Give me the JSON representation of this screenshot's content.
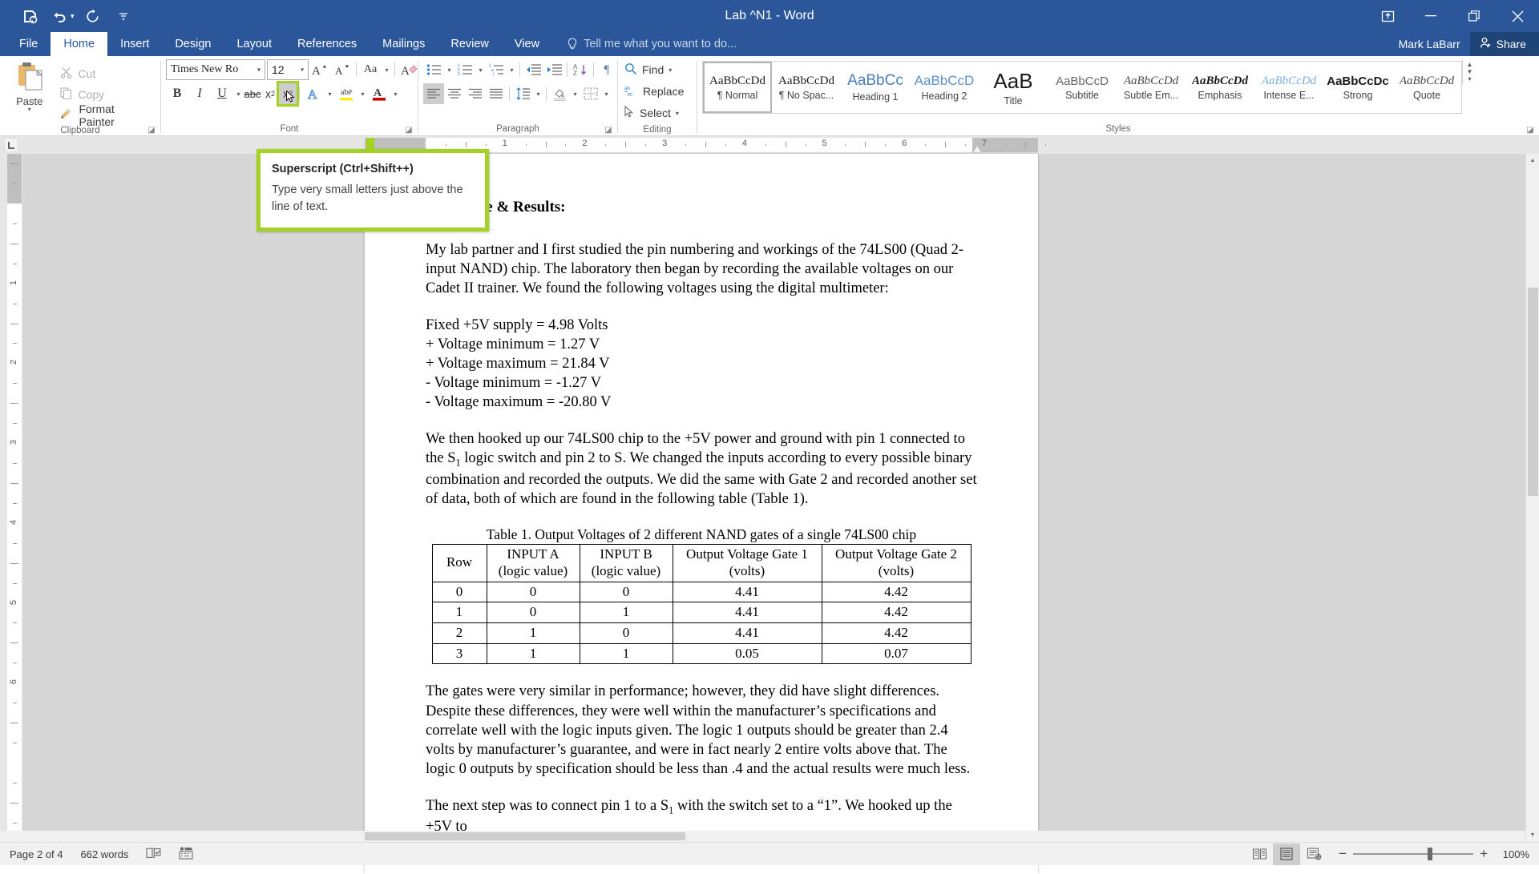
{
  "titlebar": {
    "document_title": "Lab ^N1 - Word",
    "quick_access": [
      {
        "name": "save-icon",
        "label": "Save"
      },
      {
        "name": "undo-icon",
        "label": "Undo"
      },
      {
        "name": "redo-icon",
        "label": "Redo"
      },
      {
        "name": "customize-qat-icon",
        "label": "Customize Quick Access Toolbar"
      }
    ],
    "window_controls": [
      {
        "name": "ribbon-display-options-icon",
        "label": "Ribbon Display Options"
      },
      {
        "name": "minimize-icon",
        "label": "Minimize"
      },
      {
        "name": "restore-icon",
        "label": "Restore Down"
      },
      {
        "name": "close-icon",
        "label": "Close"
      }
    ]
  },
  "tabs": [
    {
      "label": "File",
      "active": false
    },
    {
      "label": "Home",
      "active": true
    },
    {
      "label": "Insert",
      "active": false
    },
    {
      "label": "Design",
      "active": false
    },
    {
      "label": "Layout",
      "active": false
    },
    {
      "label": "References",
      "active": false
    },
    {
      "label": "Mailings",
      "active": false
    },
    {
      "label": "Review",
      "active": false
    },
    {
      "label": "View",
      "active": false
    }
  ],
  "tell_me": "Tell me what you want to do...",
  "account": {
    "user_name": "Mark LaBarr",
    "share_label": "Share"
  },
  "ribbon": {
    "clipboard": {
      "group_label": "Clipboard",
      "paste_label": "Paste",
      "cut_label": "Cut",
      "copy_label": "Copy",
      "format_painter_label": "Format Painter"
    },
    "font": {
      "group_label": "Font",
      "font_name": "Times New Ro",
      "font_size": "12",
      "buttons": [
        {
          "name": "grow-font-icon",
          "label": "Increase Font Size"
        },
        {
          "name": "shrink-font-icon",
          "label": "Decrease Font Size"
        },
        {
          "name": "change-case-icon",
          "label": "Change Case"
        },
        {
          "name": "clear-formatting-icon",
          "label": "Clear All Formatting"
        },
        {
          "name": "bold-icon",
          "label": "Bold"
        },
        {
          "name": "italic-icon",
          "label": "Italic"
        },
        {
          "name": "underline-icon",
          "label": "Underline"
        },
        {
          "name": "strikethrough-icon",
          "label": "Strikethrough"
        },
        {
          "name": "subscript-icon",
          "label": "Subscript"
        },
        {
          "name": "superscript-icon",
          "label": "Superscript"
        },
        {
          "name": "text-effects-icon",
          "label": "Text Effects and Typography"
        },
        {
          "name": "text-highlight-color-icon",
          "label": "Text Highlight Color"
        },
        {
          "name": "font-color-icon",
          "label": "Font Color"
        }
      ]
    },
    "paragraph": {
      "group_label": "Paragraph",
      "buttons": [
        {
          "name": "bullets-icon",
          "label": "Bullets"
        },
        {
          "name": "numbering-icon",
          "label": "Numbering"
        },
        {
          "name": "multilevel-list-icon",
          "label": "Multilevel List"
        },
        {
          "name": "decrease-indent-icon",
          "label": "Decrease Indent"
        },
        {
          "name": "increase-indent-icon",
          "label": "Increase Indent"
        },
        {
          "name": "sort-icon",
          "label": "Sort"
        },
        {
          "name": "show-formatting-marks-icon",
          "label": "Show/Hide Formatting Marks"
        },
        {
          "name": "align-left-icon",
          "label": "Align Left"
        },
        {
          "name": "align-center-icon",
          "label": "Center"
        },
        {
          "name": "align-right-icon",
          "label": "Align Right"
        },
        {
          "name": "justify-icon",
          "label": "Justify"
        },
        {
          "name": "line-spacing-icon",
          "label": "Line and Paragraph Spacing"
        },
        {
          "name": "shading-icon",
          "label": "Shading"
        },
        {
          "name": "borders-icon",
          "label": "Borders"
        }
      ]
    },
    "editing": {
      "group_label": "Editing",
      "find_label": "Find",
      "replace_label": "Replace",
      "select_label": "Select"
    },
    "styles": {
      "group_label": "Styles",
      "items": [
        {
          "preview": "AaBbCcDd",
          "name": "¶ Normal",
          "kind": "normal",
          "selected": true
        },
        {
          "preview": "AaBbCcDd",
          "name": "¶ No Spac...",
          "kind": "normal",
          "selected": false
        },
        {
          "preview": "AaBbCc",
          "name": "Heading 1",
          "kind": "heading1",
          "selected": false
        },
        {
          "preview": "AaBbCcD",
          "name": "Heading 2",
          "kind": "heading2",
          "selected": false
        },
        {
          "preview": "AaB",
          "name": "Title",
          "kind": "title",
          "selected": false
        },
        {
          "preview": "AaBbCcD",
          "name": "Subtitle",
          "kind": "subtitle",
          "selected": false
        },
        {
          "preview": "AaBbCcDd",
          "name": "Subtle Em...",
          "kind": "subtle-em",
          "selected": false
        },
        {
          "preview": "AaBbCcDd",
          "name": "Emphasis",
          "kind": "emphasis",
          "selected": false
        },
        {
          "preview": "AaBbCcDd",
          "name": "Intense E...",
          "kind": "intense",
          "selected": false
        },
        {
          "preview": "AaBbCcDc",
          "name": "Strong",
          "kind": "strong",
          "selected": false
        },
        {
          "preview": "AaBbCcDd",
          "name": "Quote",
          "kind": "quote",
          "selected": false
        }
      ]
    }
  },
  "tooltip": {
    "title": "Superscript (Ctrl+Shift++)",
    "description": "Type very small letters just above the line of text."
  },
  "ruler": {
    "horizontal_marks": [
      "1",
      "2",
      "3",
      "4",
      "5",
      "6",
      "7"
    ],
    "vertical_marks": [
      "1",
      "2",
      "3",
      "4",
      "5",
      "6"
    ]
  },
  "document": {
    "heading": "Procedure & Results:",
    "paragraph1": "My lab partner and I first studied the pin numbering and workings of the 74LS00 (Quad 2-input NAND) chip. The laboratory then began by recording the available voltages on our Cadet II trainer. We found the following voltages using the digital multimeter:",
    "voltage_lines": [
      "Fixed +5V supply = 4.98 Volts",
      "+ Voltage minimum = 1.27 V",
      "+ Voltage maximum = 21.84 V",
      "- Voltage minimum = -1.27 V",
      "- Voltage maximum = -20.80 V"
    ],
    "paragraph2_a": "We then hooked up our 74LS00 chip to the +5V power and ground with pin 1 connected to the S",
    "paragraph2_sub": "1",
    "paragraph2_b": " logic switch and pin 2 to S. We changed the inputs according to every possible binary combination and recorded the outputs. We did the same with Gate 2 and recorded another set of data, both of which are found in the following table (Table 1).",
    "table_caption": "Table 1. Output Voltages of 2 different NAND gates of a single 74LS00 chip",
    "table": {
      "headers": [
        [
          "Row",
          ""
        ],
        [
          "INPUT A",
          "(logic value)"
        ],
        [
          "INPUT B",
          "(logic value)"
        ],
        [
          "Output Voltage Gate 1",
          "(volts)"
        ],
        [
          "Output Voltage Gate 2",
          "(volts)"
        ]
      ],
      "rows": [
        [
          "0",
          "0",
          "0",
          "4.41",
          "4.42"
        ],
        [
          "1",
          "0",
          "1",
          "4.41",
          "4.42"
        ],
        [
          "2",
          "1",
          "0",
          "4.41",
          "4.42"
        ],
        [
          "3",
          "1",
          "1",
          "0.05",
          "0.07"
        ]
      ]
    },
    "paragraph3": "The gates were very similar in performance; however, they did have slight differences. Despite these differences, they were well within the manufacturer’s specifications and correlate well with the logic inputs given. The logic 1 outputs should be greater than 2.4 volts by manufacturer’s guarantee, and were in fact nearly 2 entire volts above that. The logic 0 outputs by specification should be less than .4 and the actual results were much less.",
    "paragraph4_a": "The next step was to connect pin 1 to a S",
    "paragraph4_sub": "1",
    "paragraph4_b": " with the switch set to a “1”. We hooked up the +5V to"
  },
  "statusbar": {
    "page_info": "Page 2 of 4",
    "word_count": "662 words",
    "proofing_icon": "spelling-and-grammar-check-icon",
    "macro_icon": "macro-recording-icon",
    "views": [
      {
        "name": "read-mode-icon",
        "label": "Read Mode",
        "active": false
      },
      {
        "name": "print-layout-icon",
        "label": "Print Layout",
        "active": true
      },
      {
        "name": "web-layout-icon",
        "label": "Web Layout",
        "active": false
      }
    ],
    "zoom_out_label": "−",
    "zoom_in_label": "+",
    "zoom_level": "100%"
  },
  "colors": {
    "brand_blue": "#2b579a",
    "share_blue": "#1f4478",
    "highlight_green": "#a4d223",
    "workspace_gray": "#d6d6d6"
  }
}
